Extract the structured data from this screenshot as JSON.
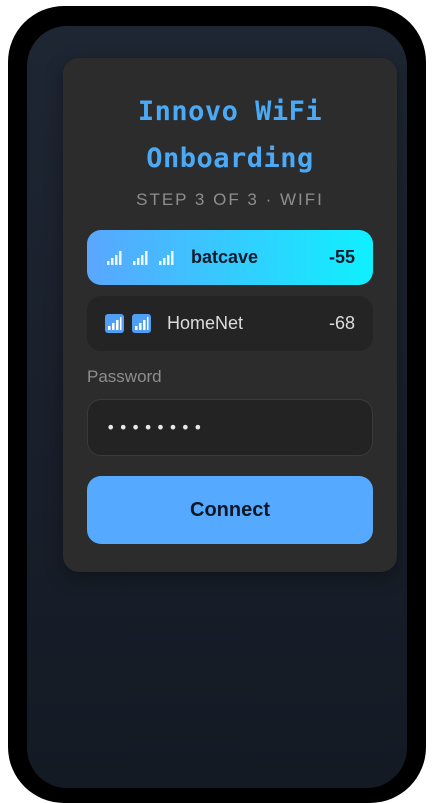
{
  "app": {
    "title_line1": "Innovo WiFi",
    "title_line2": "Onboarding",
    "subtitle": "STEP 3 OF 3 · WIFI"
  },
  "networks": [
    {
      "ssid": "batcave",
      "rssi": "-55",
      "selected": true,
      "icons": [
        "signal-bars-icon",
        "signal-bars-icon",
        "signal-bars-icon"
      ]
    },
    {
      "ssid": "HomeNet",
      "rssi": "-68",
      "selected": false,
      "icons": [
        "signal-bars-icon",
        "signal-bars-icon"
      ]
    }
  ],
  "password": {
    "label": "Password",
    "value": "••••••••"
  },
  "connect_button": {
    "label": "Connect"
  },
  "colors": {
    "accent": "#4aaaf7",
    "selected_gradient_start": "#5aa6ff",
    "selected_gradient_end": "#0ff0ff",
    "button": "#55aaff",
    "card": "#2c2c2c"
  }
}
